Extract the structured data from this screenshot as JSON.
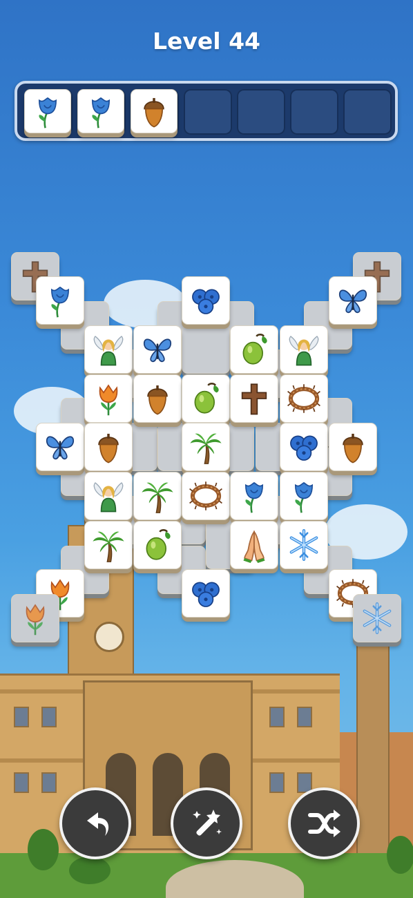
{
  "header": {
    "level_label": "Level 44"
  },
  "tray": {
    "capacity": 7,
    "tiles": [
      "blue-rose",
      "blue-rose",
      "acorn"
    ]
  },
  "board": {
    "tiles": [
      {
        "icon": "cross",
        "dim": true
      },
      {
        "icon": "cross",
        "dim": true
      },
      {
        "icon": "blue-rose"
      },
      {
        "icon": "blueberries"
      },
      {
        "icon": "butterfly"
      },
      {
        "icon": "angel"
      },
      {
        "icon": "butterfly"
      },
      {
        "icon": "olive"
      },
      {
        "icon": "angel"
      },
      {
        "icon": "tulip"
      },
      {
        "icon": "acorn"
      },
      {
        "icon": "olive"
      },
      {
        "icon": "cross"
      },
      {
        "icon": "crown-of-thorns"
      },
      {
        "icon": "butterfly"
      },
      {
        "icon": "acorn"
      },
      {
        "icon": "palm-tree"
      },
      {
        "icon": "blueberries"
      },
      {
        "icon": "acorn"
      },
      {
        "icon": "angel"
      },
      {
        "icon": "palm-tree"
      },
      {
        "icon": "crown-of-thorns"
      },
      {
        "icon": "blue-rose"
      },
      {
        "icon": "blue-rose"
      },
      {
        "icon": "palm-tree"
      },
      {
        "icon": "olive"
      },
      {
        "icon": "praying-hands"
      },
      {
        "icon": "snowflake"
      },
      {
        "icon": "tulip"
      },
      {
        "icon": "blueberries"
      },
      {
        "icon": "crown-of-thorns"
      },
      {
        "icon": "tulip",
        "dim": true
      },
      {
        "icon": "snowflake",
        "dim": true
      }
    ]
  },
  "controls": {
    "undo": "undo-icon",
    "hint": "magic-wand-icon",
    "shuffle": "shuffle-icon"
  },
  "colors": {
    "sky": "#3b8ad8",
    "tray": "#1c3a6b",
    "tile": "#ffffff"
  }
}
